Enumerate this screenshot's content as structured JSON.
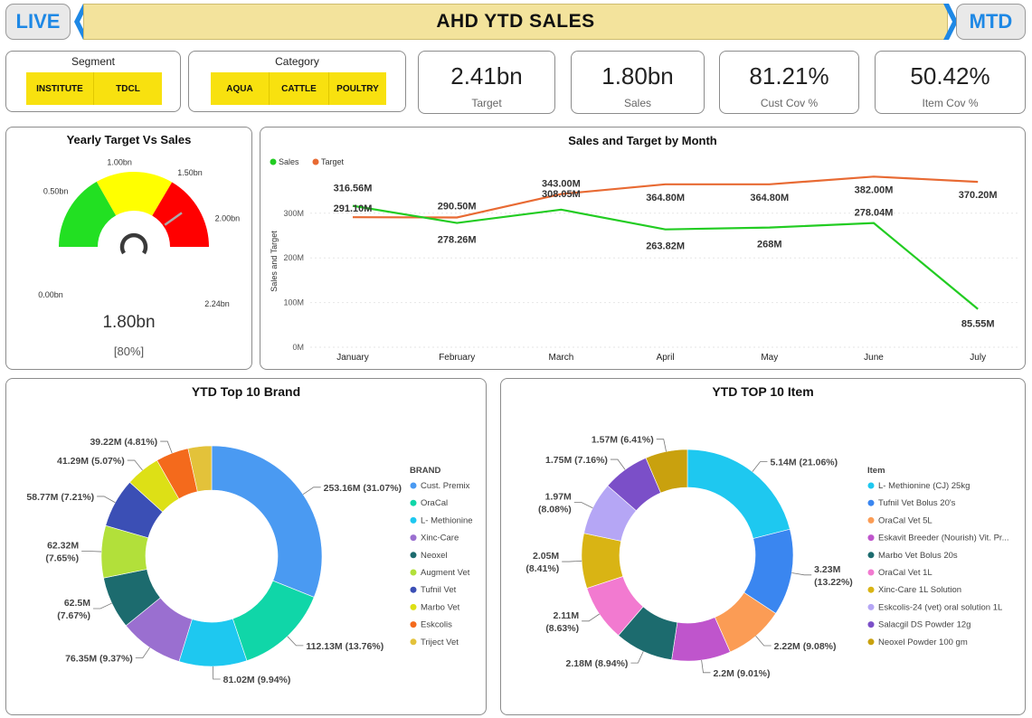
{
  "header": {
    "live_label": "LIVE",
    "title": "AHD YTD SALES",
    "mtd_label": "MTD"
  },
  "slicers": {
    "segment": {
      "title": "Segment",
      "items": [
        "INSTITUTE",
        "TDCL"
      ]
    },
    "category": {
      "title": "Category",
      "items": [
        "AQUA",
        "CATTLE",
        "POULTRY"
      ]
    }
  },
  "kpis": [
    {
      "value": "2.41bn",
      "label": "Target"
    },
    {
      "value": "1.80bn",
      "label": "Sales"
    },
    {
      "value": "81.21%",
      "label": "Cust Cov %"
    },
    {
      "value": "50.42%",
      "label": "Item Cov %"
    }
  ],
  "gauge": {
    "title": "Yearly Target Vs Sales",
    "value": 1.8,
    "value_label": "1.80bn",
    "percent_label": "[80%]",
    "max": 2.24,
    "ticks": [
      "0.00bn",
      "0.50bn",
      "1.00bn",
      "1.50bn",
      "2.00bn",
      "2.24bn"
    ],
    "bands": [
      {
        "from": 0.0,
        "to": 0.75,
        "color": "#22e022"
      },
      {
        "from": 0.75,
        "to": 1.5,
        "color": "#ffff00"
      },
      {
        "from": 1.5,
        "to": 2.24,
        "color": "#ff0000"
      }
    ],
    "needle_color": "#aaaaaa"
  },
  "line_chart": {
    "title": "Sales and Target by Month",
    "ylabel": "Sales and Target",
    "legend": [
      "Sales",
      "Target"
    ],
    "y_ticks": [
      "0M",
      "100M",
      "200M",
      "300M"
    ],
    "colors": {
      "Sales": "#22cc22",
      "Target": "#e86a33"
    }
  },
  "brand_chart": {
    "title": "YTD Top 10 Brand",
    "legend_title": "BRAND"
  },
  "item_chart": {
    "title": "YTD TOP 10 Item",
    "legend_title": "Item"
  },
  "chart_data": [
    {
      "type": "line",
      "title": "Sales and Target by Month",
      "xlabel": "",
      "ylabel": "Sales and Target",
      "x": [
        "January",
        "February",
        "March",
        "April",
        "May",
        "June",
        "July"
      ],
      "ylim": [
        0,
        400
      ],
      "series": [
        {
          "name": "Sales",
          "values": [
            316.56,
            278.26,
            308.05,
            263.82,
            268,
            278.04,
            85.55
          ],
          "labels": [
            "316.56M",
            "278.26M",
            "308.05M",
            "263.82M",
            "268M",
            "278.04M",
            "85.55M"
          ]
        },
        {
          "name": "Target",
          "values": [
            291.1,
            290.5,
            343.0,
            364.8,
            364.8,
            382.0,
            370.2
          ],
          "labels": [
            "291.10M",
            "290.50M",
            "343.00M",
            "364.80M",
            "364.80M",
            "382.00M",
            "370.20M"
          ]
        }
      ]
    },
    {
      "type": "pie",
      "title": "YTD Top 10 Brand",
      "categories": [
        "Cust. Premix",
        "OraCal",
        "L- Methionine",
        "Xinc-Care",
        "Neoxel",
        "Augment Vet",
        "Tufnil Vet",
        "Marbo Vet",
        "Eskcolis",
        "Triject Vet"
      ],
      "values": [
        253.16,
        112.13,
        81.02,
        76.35,
        62.5,
        62.32,
        58.77,
        41.29,
        39.22,
        28.0
      ],
      "labels": [
        "253.16M (31.07%)",
        "112.13M (13.76%)",
        "81.02M (9.94%)",
        "76.35M (9.37%)",
        "62.5M (7.67%)",
        "62.32M (7.65%)",
        "58.77M (7.21%)",
        "41.29M (5.07%)",
        "39.22M (4.81%)",
        ""
      ],
      "colors": [
        "#4a9af2",
        "#10d6a8",
        "#1ec8f0",
        "#9a6fd0",
        "#1c6b6e",
        "#b2e03a",
        "#3b4fb5",
        "#dde016",
        "#f46a1c",
        "#e3c23a"
      ]
    },
    {
      "type": "pie",
      "title": "YTD TOP 10 Item",
      "categories": [
        "L- Methionine (CJ) 25kg",
        "Tufnil Vet Bolus 20's",
        "OraCal Vet 5L",
        "Eskavit Breeder (Nourish) Vit. Pr...",
        "Marbo Vet Bolus 20s",
        "OraCal Vet 1L",
        "Xinc-Care 1L Solution",
        "Eskcolis-24 (vet) oral solution 1L",
        "Salacgil DS Powder 12g",
        "Neoxel Powder 100 gm"
      ],
      "values": [
        5.14,
        3.23,
        2.22,
        2.2,
        2.18,
        2.11,
        2.05,
        1.97,
        1.75,
        1.57
      ],
      "labels": [
        "5.14M (21.06%)",
        "3.23M (13.22%)",
        "2.22M (9.08%)",
        "2.2M (9.01%)",
        "2.18M (8.94%)",
        "2.11M (8.63%)",
        "2.05M (8.41%)",
        "1.97M (8.08%)",
        "1.75M (7.16%)",
        "1.57M (6.41%)"
      ],
      "colors": [
        "#1ec8f0",
        "#3a86f0",
        "#fb9c55",
        "#bf55cc",
        "#1c6b6e",
        "#f27ad0",
        "#d9b414",
        "#b5a6f5",
        "#7b4fc8",
        "#c9a10e"
      ]
    }
  ]
}
